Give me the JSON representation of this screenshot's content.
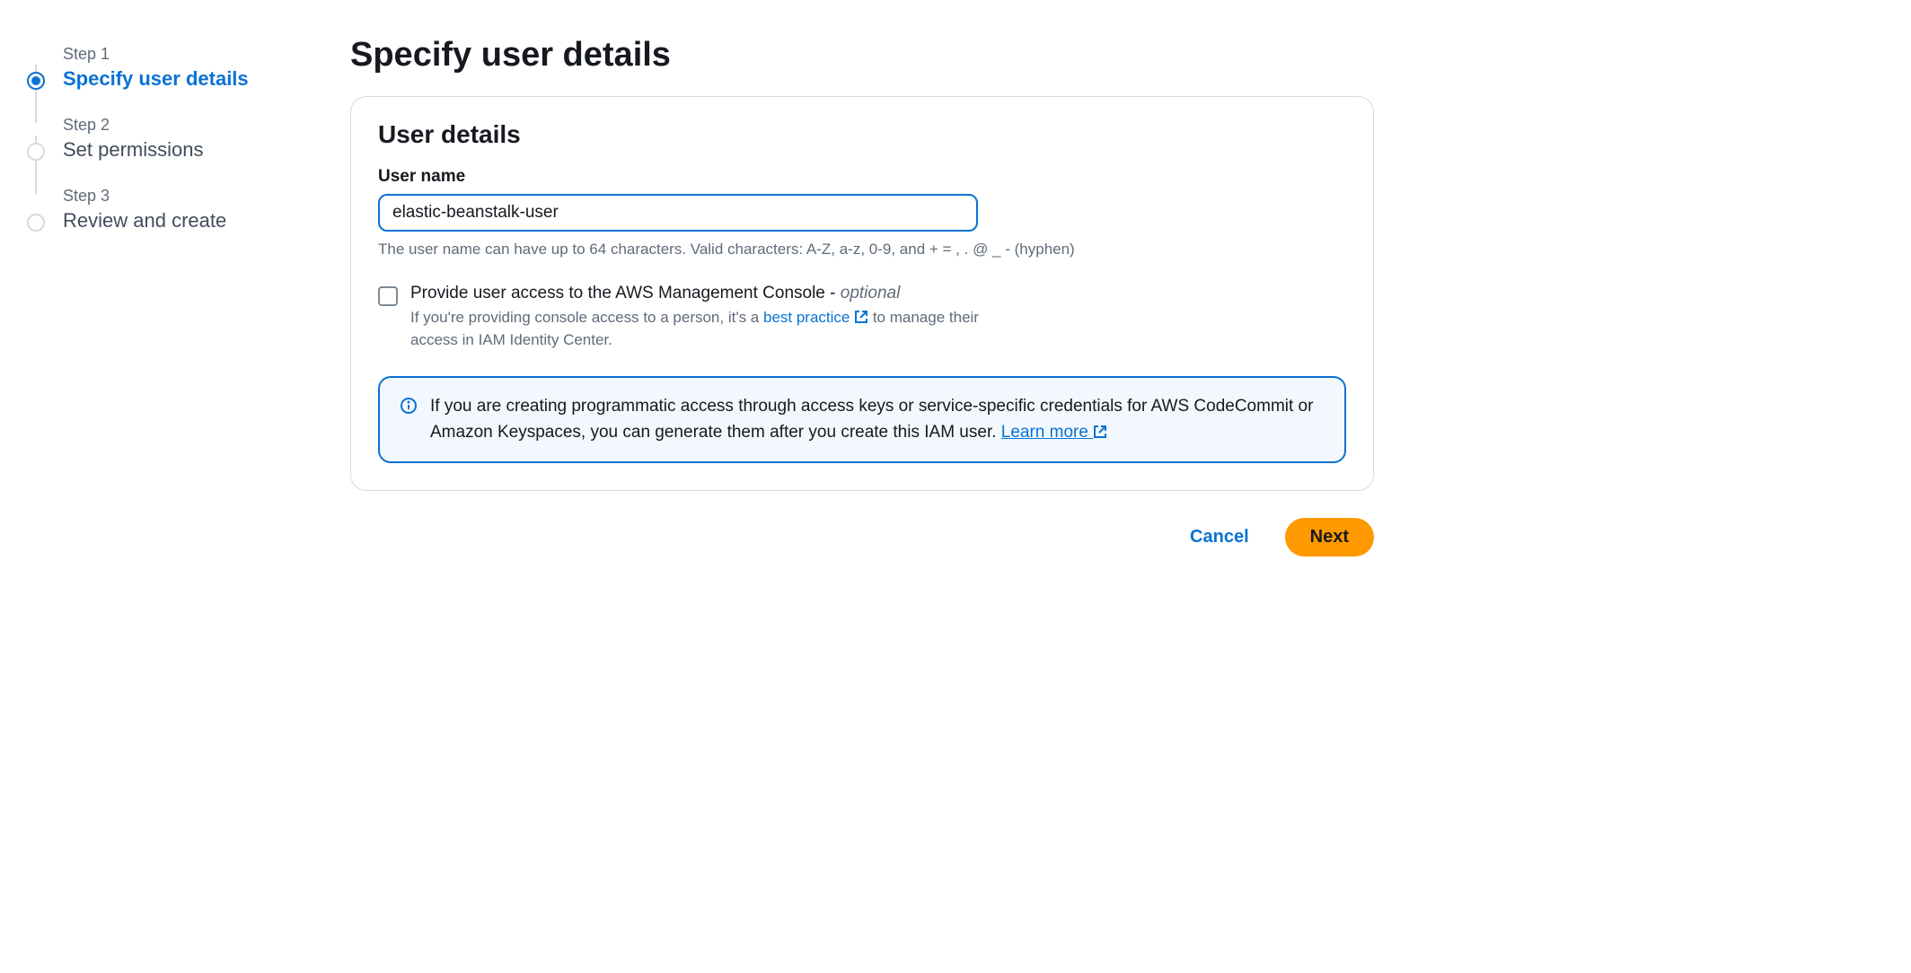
{
  "wizard": {
    "steps": [
      {
        "label": "Step 1",
        "title": "Specify user details"
      },
      {
        "label": "Step 2",
        "title": "Set permissions"
      },
      {
        "label": "Step 3",
        "title": "Review and create"
      }
    ]
  },
  "page": {
    "title": "Specify user details"
  },
  "panel": {
    "title": "User details",
    "username_label": "User name",
    "username_value": "elastic-beanstalk-user",
    "username_hint": "The user name can have up to 64 characters. Valid characters: A-Z, a-z, 0-9, and + = , . @ _ - (hyphen)"
  },
  "console_access": {
    "label_main": "Provide user access to the AWS Management Console - ",
    "label_optional": "optional",
    "desc_prefix": "If you're providing console access to a person, it's a ",
    "best_practice_link": "best practice",
    "desc_suffix": " to manage their access in IAM Identity Center."
  },
  "info": {
    "text": "If you are creating programmatic access through access keys or service-specific credentials for AWS CodeCommit or Amazon Keyspaces, you can generate them after you create this IAM user. ",
    "learn_more": "Learn more"
  },
  "actions": {
    "cancel": "Cancel",
    "next": "Next"
  }
}
